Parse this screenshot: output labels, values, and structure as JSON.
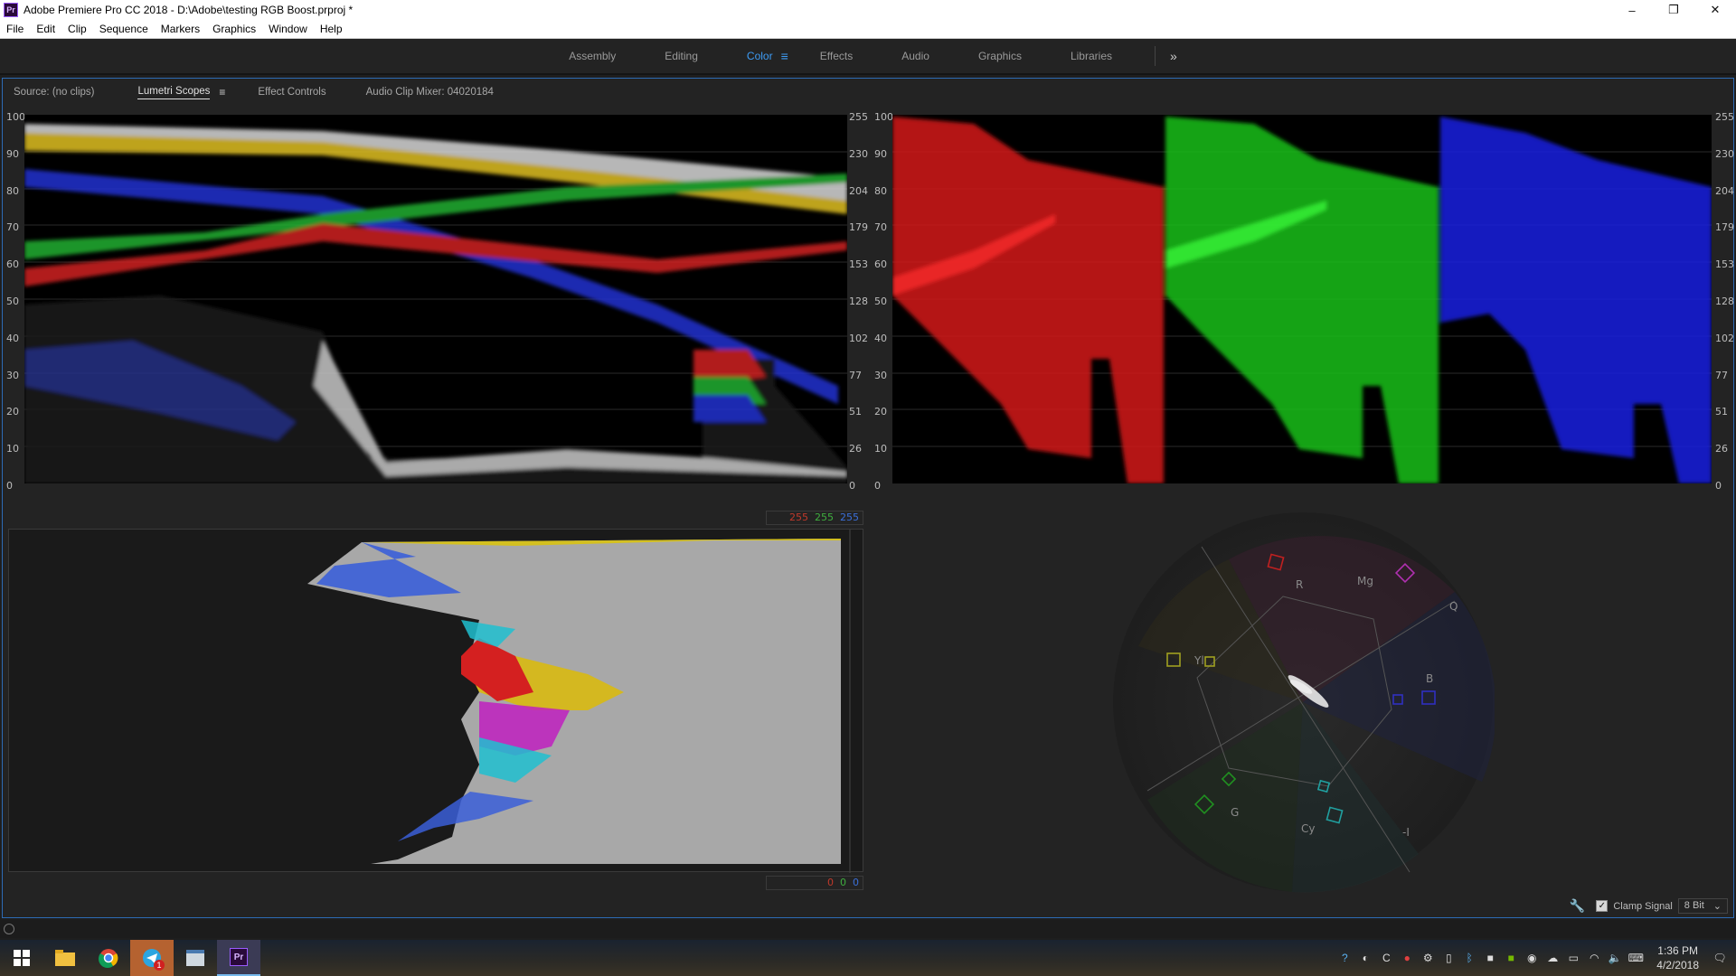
{
  "window": {
    "app_icon": "Pr",
    "title": "Adobe Premiere Pro CC 2018 - D:\\Adobe\\testing RGB Boost.prproj *",
    "controls": {
      "minimize": "–",
      "restore": "❐",
      "close": "✕"
    }
  },
  "menu": [
    "File",
    "Edit",
    "Clip",
    "Sequence",
    "Markers",
    "Graphics",
    "Window",
    "Help"
  ],
  "workspaces": {
    "items": [
      "Assembly",
      "Editing",
      "Color",
      "Effects",
      "Audio",
      "Graphics",
      "Libraries"
    ],
    "active": "Color",
    "more": "»"
  },
  "panel": {
    "tabs": [
      "Source: (no clips)",
      "Lumetri Scopes",
      "Effect Controls",
      "Audio Clip Mixer: 04020184"
    ],
    "active_tab": "Lumetri Scopes",
    "menu_icon": "≡"
  },
  "waveform": {
    "ire_scale": [
      "100",
      "90",
      "80",
      "70",
      "60",
      "50",
      "40",
      "30",
      "20",
      "10",
      "0"
    ],
    "code_scale": [
      "255",
      "230",
      "204",
      "179",
      "153",
      "128",
      "102",
      "77",
      "51",
      "26",
      "0"
    ]
  },
  "histogram": {
    "top_values": {
      "r": "255",
      "g": "255",
      "b": "255"
    },
    "bottom_values": {
      "r": "0",
      "g": "0",
      "b": "0"
    },
    "colors": {
      "r": "#c0392b",
      "g": "#3fae3f",
      "b": "#3b6fd8"
    }
  },
  "vectorscope": {
    "targets": [
      "R",
      "Mg",
      "B",
      "Cy",
      "G",
      "Yl"
    ],
    "axes": [
      "Q",
      "-I"
    ]
  },
  "footer": {
    "clamp_label": "Clamp Signal",
    "clamp_checked": true,
    "bit_depth": "8 Bit",
    "dropdown_arrow": "⌄"
  },
  "taskbar": {
    "clock_time": "1:36 PM",
    "clock_date": "4/2/2018",
    "telegram_badge": "1"
  }
}
